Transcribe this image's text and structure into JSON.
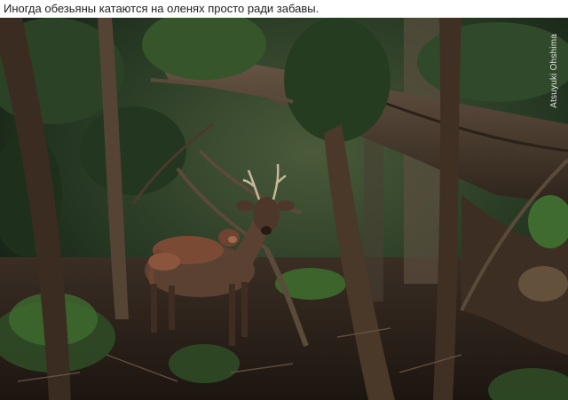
{
  "caption": "Иногда обезьяны катаются на оленях просто ради забавы.",
  "photo": {
    "credit": "Atsuyuki Ohshima",
    "subjects": [
      "deer",
      "monkey",
      "forest"
    ],
    "palette": {
      "foliage_dark": "#1c2e1a",
      "foliage_light": "#3f6b2f",
      "bark": "#4b3a2c",
      "deer": "#5a4132",
      "monkey": "#7a4a35"
    }
  }
}
